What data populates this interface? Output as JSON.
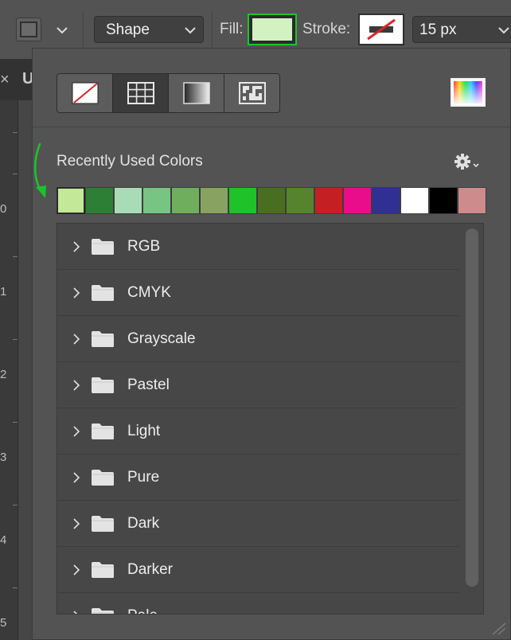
{
  "options_bar": {
    "shape_mode_label": "Shape",
    "fill_label": "Fill:",
    "fill_color": "#d2f2c2",
    "fill_highlight_color": "#22c32a",
    "stroke_label": "Stroke:",
    "stroke_width": "15 px"
  },
  "document": {
    "tab_close": "×",
    "tab_title_fragment": "U",
    "ruler_labels": [
      "0",
      "1",
      "2",
      "3",
      "4",
      "5"
    ]
  },
  "swatch_panel": {
    "type_buttons": [
      {
        "name": "no-color",
        "icon": "none-slash-icon",
        "active": false
      },
      {
        "name": "solid-color",
        "icon": "grid-swatch-icon",
        "active": true
      },
      {
        "name": "gradient",
        "icon": "gradient-icon",
        "active": false
      },
      {
        "name": "pattern",
        "icon": "pattern-icon",
        "active": false
      }
    ],
    "color_picker_icon": "color-picker-icon",
    "recent_title": "Recently Used Colors",
    "settings_icon": "gear-icon",
    "recent_colors": [
      "#c3e898",
      "#2c7f34",
      "#a9dcb6",
      "#78c483",
      "#6eae5d",
      "#88a262",
      "#1fc228",
      "#4a6e20",
      "#56832e",
      "#c42024",
      "#ea0d8b",
      "#2f2f94",
      "#ffffff",
      "#000000",
      "#cd8b8b"
    ],
    "annotation_arrow_color": "#19c42a",
    "folders": [
      {
        "label": "RGB"
      },
      {
        "label": "CMYK"
      },
      {
        "label": "Grayscale"
      },
      {
        "label": "Pastel"
      },
      {
        "label": "Light"
      },
      {
        "label": "Pure"
      },
      {
        "label": "Dark"
      },
      {
        "label": "Darker"
      },
      {
        "label": "Pale"
      }
    ]
  }
}
